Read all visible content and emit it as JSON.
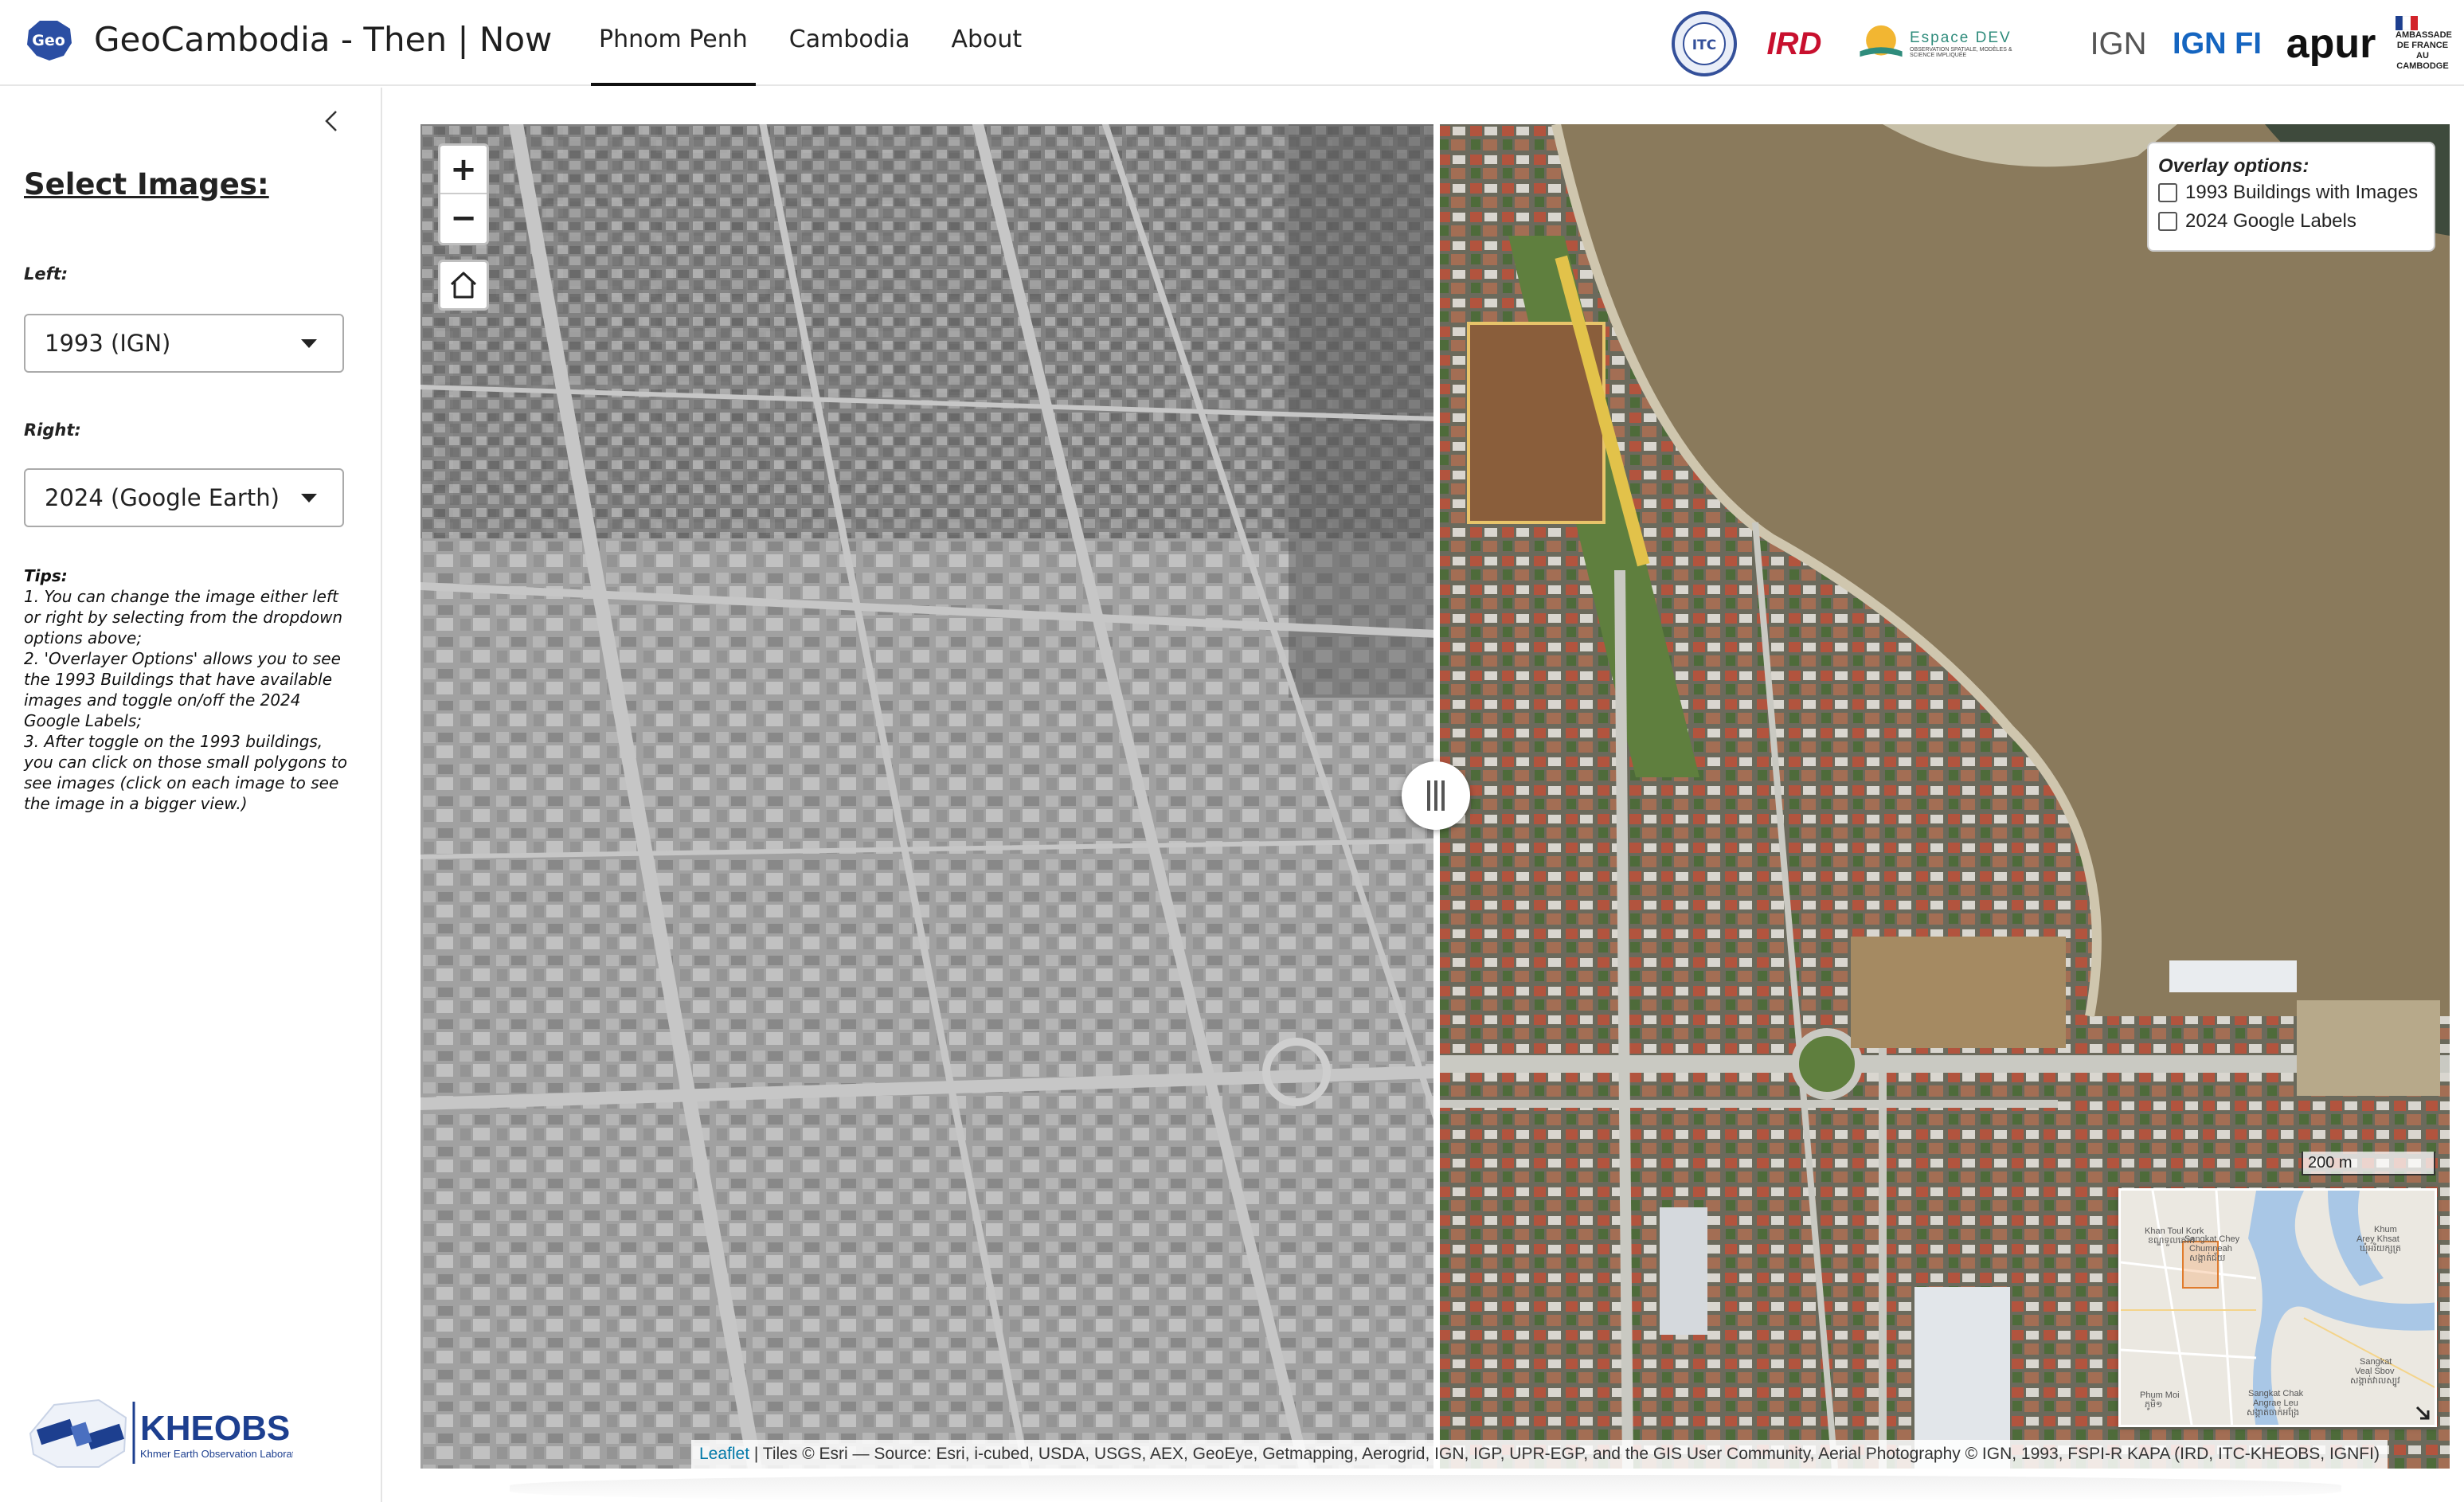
{
  "header": {
    "title": "GeoCambodia - Then | Now",
    "logo_text": "Geo",
    "tabs": [
      {
        "label": "Phnom Penh",
        "active": true
      },
      {
        "label": "Cambodia",
        "active": false
      },
      {
        "label": "About",
        "active": false
      }
    ],
    "partners": {
      "itc": "ITC",
      "ird": "IRD",
      "espace": "Espace DEV",
      "espace_sub": "OBSERVATION SPATIALE, MODÈLES & SCIENCE IMPLIQUÉE",
      "ign": "IGN",
      "ignfi": "IGN FI",
      "apur": "apur",
      "ambassade": "AMBASSADE DE FRANCE AU CAMBODGE"
    }
  },
  "sidebar": {
    "title": "Select Images:",
    "left_label": "Left:",
    "left_value": "1993 (IGN)",
    "right_label": "Right:",
    "right_value": "2024 (Google Earth)",
    "tips_heading": "Tips:",
    "tips": [
      "1. You can change the image either left or right by selecting from the dropdown options above;",
      "2. 'Overlayer Options' allows you to see the 1993 Buildings that have available images and toggle on/off the 2024 Google Labels;",
      "3. After toggle on the 1993 buildings, you can click on those small polygons to see images (click on each image to see the image in a bigger view.)"
    ],
    "kheobs_name": "KHEOBS",
    "kheobs_subtitle": "Khmer Earth Observation Laboratory"
  },
  "map": {
    "zoom_in": "+",
    "zoom_out": "−",
    "overlay": {
      "title": "Overlay options:",
      "options": [
        {
          "label": "1993 Buildings with Images",
          "checked": false
        },
        {
          "label": "2024 Google Labels",
          "checked": false
        }
      ]
    },
    "scale_label": "200 m",
    "minimap_labels": {
      "toul_kork": "Khan Toul Kork",
      "toul_kork_kh": "ខណ្ឌទួលគោក",
      "chey": "Sangkat Chey",
      "chumneah": "Chumneah",
      "chumneah_kh": "សង្កាត់ជ័យ",
      "khum": "Khum",
      "arey": "Arey Khsat",
      "arey_kh": "ឃុំអរិយក្សត្រ",
      "veal_sbov": "Sangkat",
      "veal_sbov2": "Veal Sbov",
      "veal_sbov_kh": "សង្កាត់វាលស្បូវ",
      "phum_moi": "Phum Moi",
      "phum_moi_kh": "ភូមិ១",
      "chak": "Sangkat Chak",
      "angrae": "Angrae Leu",
      "angrae_kh": "សង្កាត់ចាក់អង្រែ"
    },
    "attribution_link": "Leaflet",
    "attribution_text": " | Tiles © Esri — Source: Esri, i-cubed, USDA, USGS, AEX, GeoEye, Getmapping, Aerogrid, IGN, IGP, UPR-EGP, and the GIS User Community, Aerial Photography © IGN, 1993, FSPI-R KAPA (IRD, ITC-KHEOBS, IGNFI)"
  },
  "colors": {
    "river": "#8a7a5c",
    "left_base": "#8f8f8f",
    "right_base": "#5d6652",
    "nav_active": "#111111",
    "link": "#0078a8",
    "kheobs_blue": "#1d3f8f"
  }
}
